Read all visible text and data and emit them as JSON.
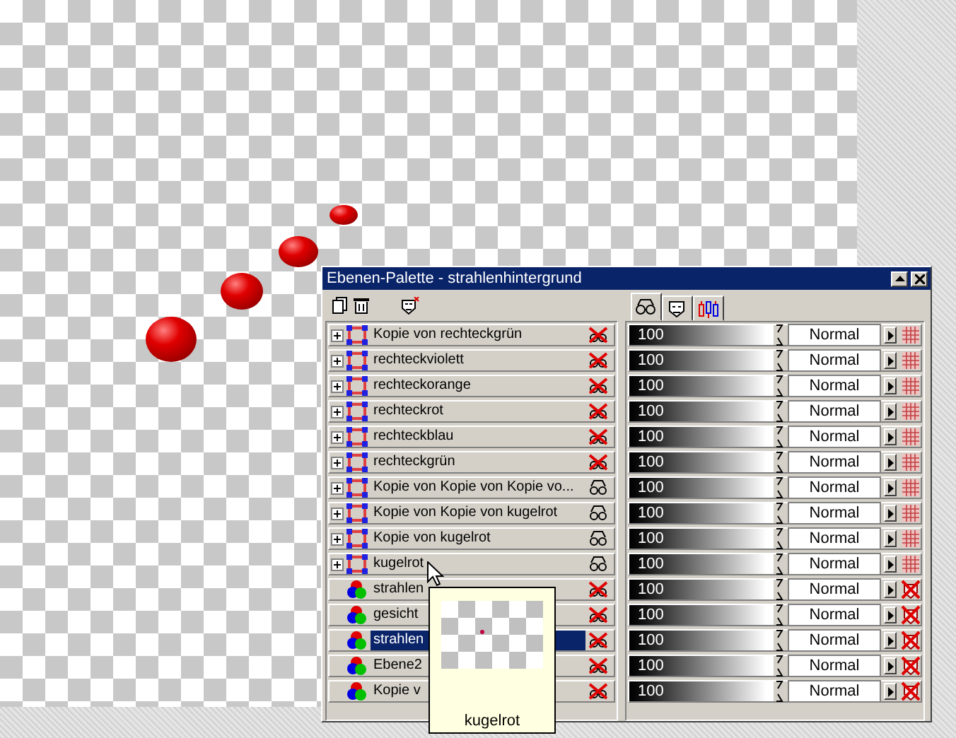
{
  "window": {
    "title": "Ebenen-Palette - strahlenhintergrund"
  },
  "tabs": [
    {
      "kind": "glasses",
      "selected": true
    },
    {
      "kind": "mask",
      "selected": false
    },
    {
      "kind": "bars",
      "selected": false
    }
  ],
  "layers": [
    {
      "name": "Kopie von rechteckgrün",
      "kind": "vector",
      "expanded": false,
      "visible": false,
      "selected": false,
      "opacity": "100",
      "level": 1,
      "blend": "Normal"
    },
    {
      "name": "rechteckviolett",
      "kind": "vector",
      "expanded": false,
      "visible": false,
      "selected": false,
      "opacity": "100",
      "level": 1,
      "blend": "Normal"
    },
    {
      "name": "rechteckorange",
      "kind": "vector",
      "expanded": false,
      "visible": false,
      "selected": false,
      "opacity": "100",
      "level": 1,
      "blend": "Normal"
    },
    {
      "name": "rechteckrot",
      "kind": "vector",
      "expanded": false,
      "visible": false,
      "selected": false,
      "opacity": "100",
      "level": 1,
      "blend": "Normal"
    },
    {
      "name": "rechteckblau",
      "kind": "vector",
      "expanded": false,
      "visible": false,
      "selected": false,
      "opacity": "100",
      "level": 1,
      "blend": "Normal"
    },
    {
      "name": "rechteckgrün",
      "kind": "vector",
      "expanded": false,
      "visible": false,
      "selected": false,
      "opacity": "100",
      "level": 1,
      "blend": "Normal"
    },
    {
      "name": "Kopie von Kopie von Kopie vo...",
      "kind": "vector",
      "expanded": false,
      "visible": true,
      "selected": false,
      "opacity": "100",
      "level": 1,
      "blend": "Normal"
    },
    {
      "name": "Kopie von Kopie von kugelrot",
      "kind": "vector",
      "expanded": false,
      "visible": true,
      "selected": false,
      "opacity": "100",
      "level": 1,
      "blend": "Normal"
    },
    {
      "name": "Kopie von kugelrot",
      "kind": "vector",
      "expanded": false,
      "visible": true,
      "selected": false,
      "opacity": "100",
      "level": 1,
      "blend": "Normal"
    },
    {
      "name": "kugelrot",
      "kind": "vector",
      "expanded": false,
      "visible": true,
      "selected": false,
      "opacity": "100",
      "level": 1,
      "blend": "Normal"
    },
    {
      "name": "strahlen",
      "kind": "raster",
      "visible": false,
      "selected": false,
      "opacity": "100",
      "level": 1,
      "blend": "Normal"
    },
    {
      "name": "gesicht",
      "kind": "raster",
      "visible": false,
      "selected": false,
      "opacity": "100",
      "level": 1,
      "blend": "Normal"
    },
    {
      "name": "strahlen",
      "kind": "raster",
      "visible": false,
      "selected": true,
      "opacity": "100",
      "level": 1,
      "blend": "Normal"
    },
    {
      "name": "Ebene2",
      "kind": "raster",
      "visible": false,
      "selected": false,
      "opacity": "100",
      "level": 1,
      "blend": "Normal"
    },
    {
      "name": "Kopie v",
      "kind": "raster",
      "visible": false,
      "selected": false,
      "opacity": "100",
      "level": 1,
      "blend": "Normal"
    }
  ],
  "tooltip": {
    "label": "kugelrot"
  }
}
